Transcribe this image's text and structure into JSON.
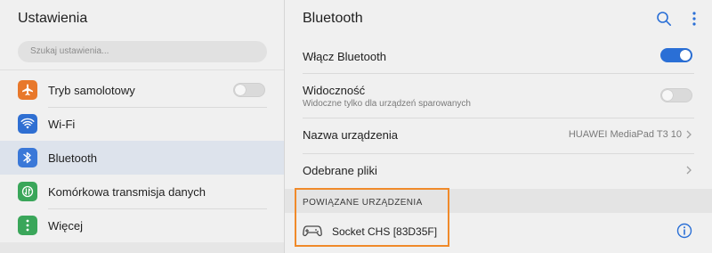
{
  "left": {
    "title": "Ustawienia",
    "search_placeholder": "Szukaj ustawienia...",
    "items": [
      {
        "label": "Tryb samolotowy",
        "icon": "airplane-icon",
        "icon_color": "#e8782b",
        "toggle": false
      },
      {
        "label": "Wi-Fi",
        "icon": "wifi-icon",
        "icon_color": "#2f6fd2"
      },
      {
        "label": "Bluetooth",
        "icon": "bluetooth-icon",
        "icon_color": "#3a78d8",
        "selected": true
      },
      {
        "label": "Komórkowa transmisja danych",
        "icon": "mobile-data-icon",
        "icon_color": "#3aa65a"
      },
      {
        "label": "Więcej",
        "icon": "more-icon",
        "icon_color": "#3aa65a"
      }
    ]
  },
  "right": {
    "title": "Bluetooth",
    "rows": [
      {
        "label": "Włącz Bluetooth",
        "toggle": true
      },
      {
        "label": "Widoczność",
        "sub": "Widoczne tylko dla urządzeń sparowanych",
        "toggle": false
      },
      {
        "label": "Nazwa urządzenia",
        "value": "HUAWEI MediaPad T3 10"
      },
      {
        "label": "Odebrane pliki"
      }
    ],
    "paired_header": "POWIĄZANE URZĄDZENIA",
    "paired_devices": [
      {
        "name": "Socket CHS [83D35F]",
        "icon": "gamepad-icon"
      }
    ]
  },
  "colors": {
    "accent": "#2a6fd6",
    "highlight": "#f08a2a"
  }
}
